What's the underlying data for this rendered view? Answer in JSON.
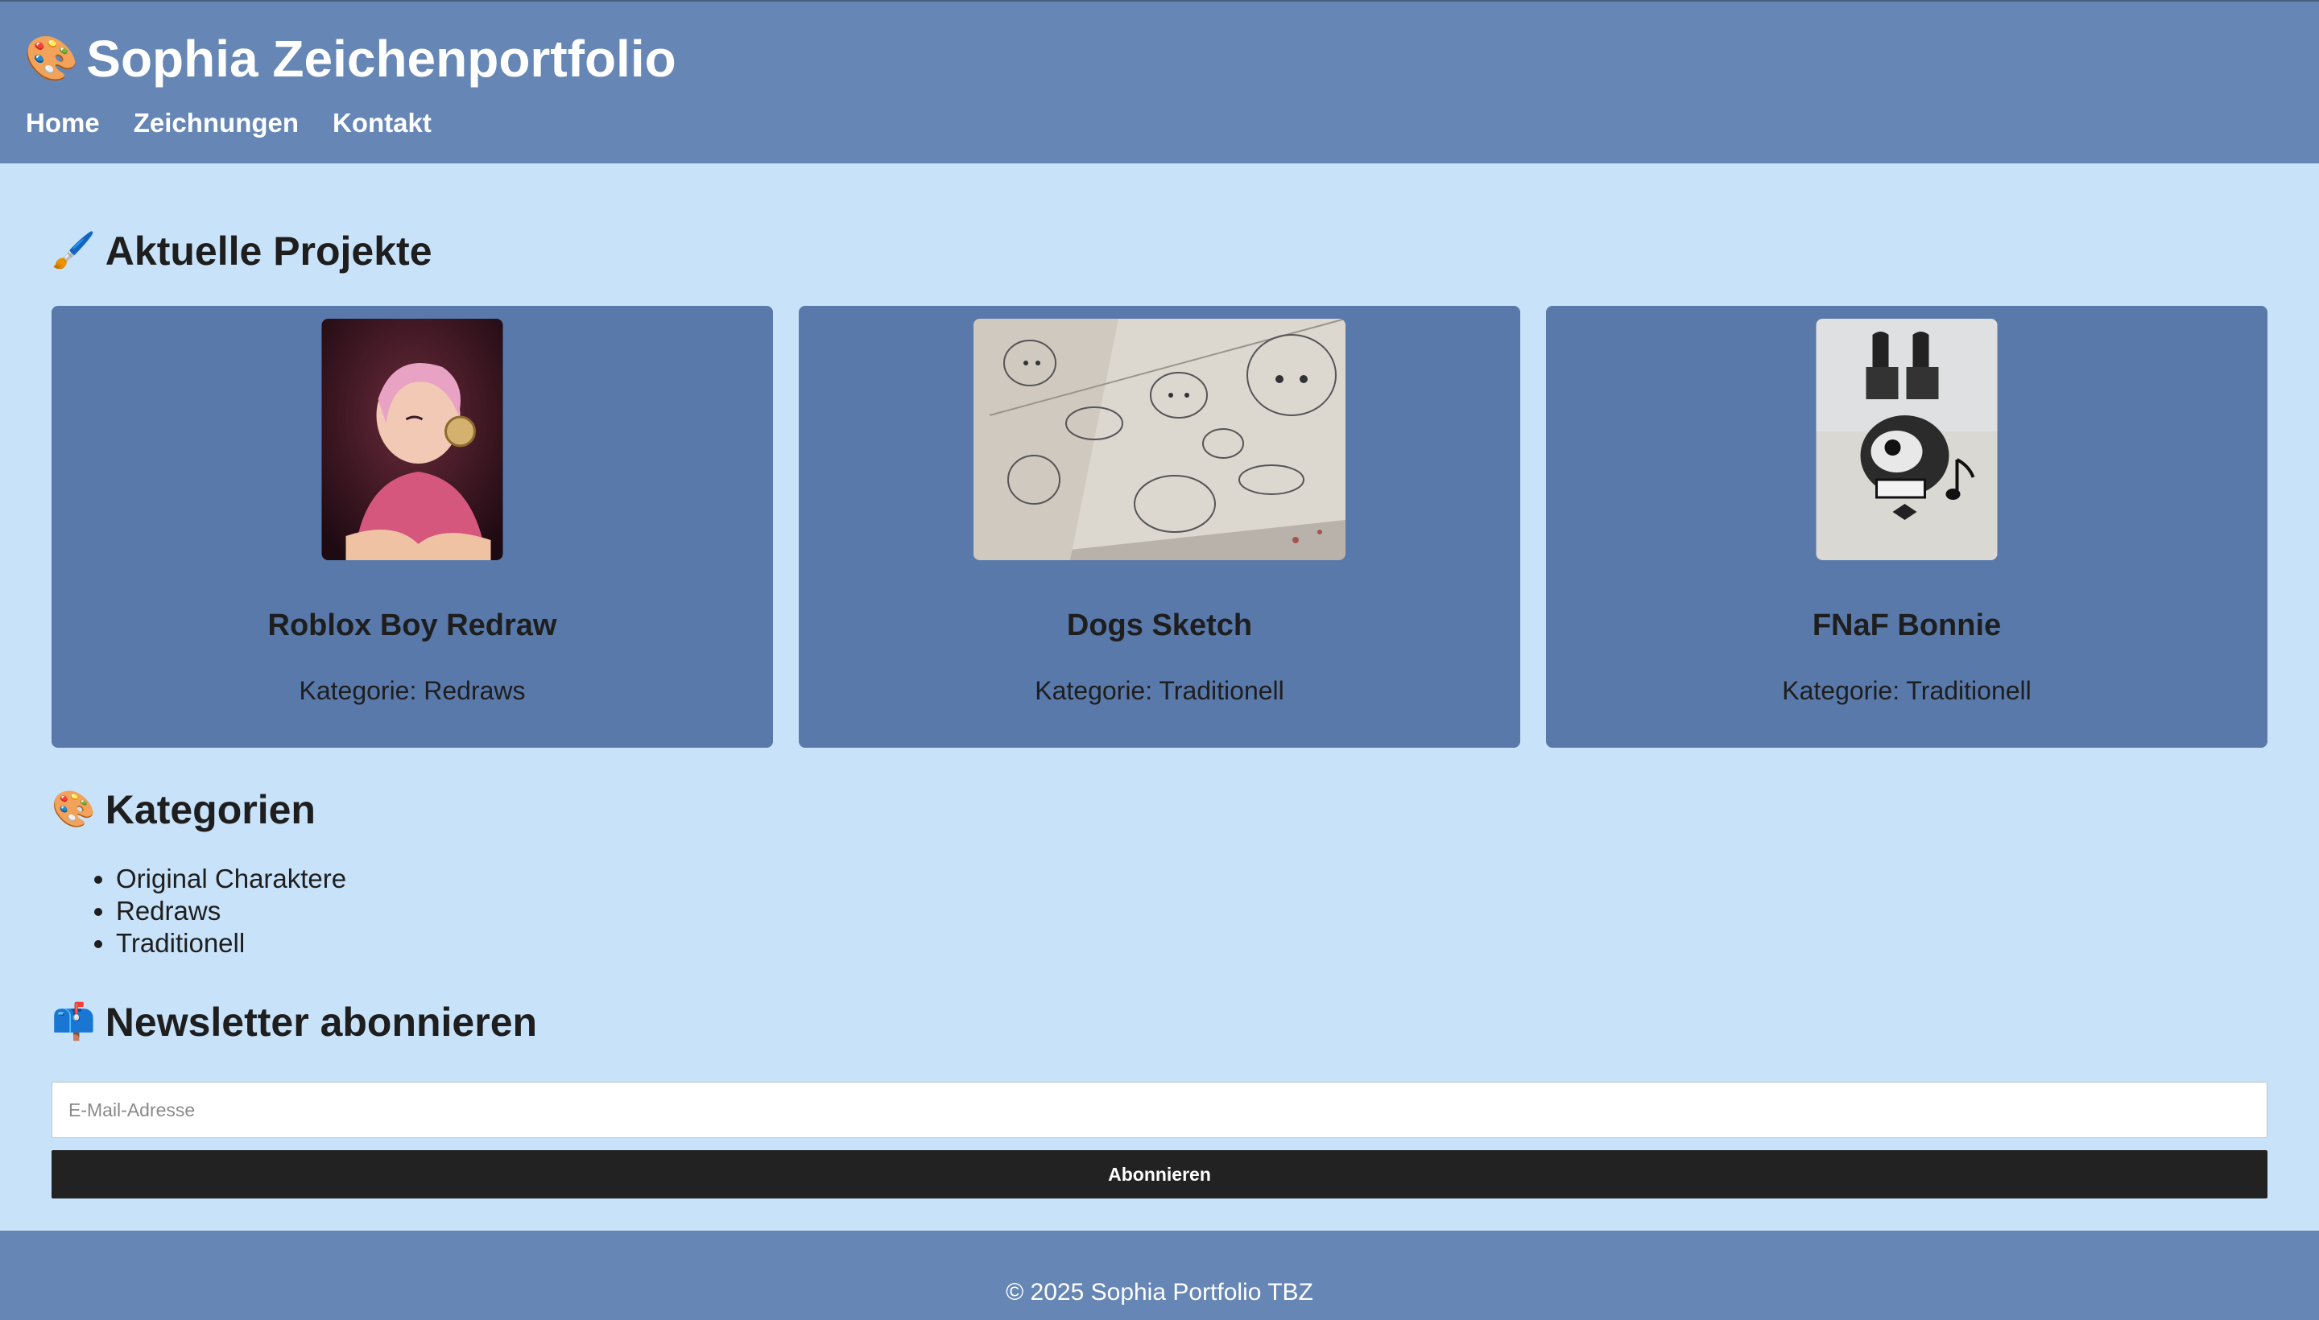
{
  "header": {
    "title_icon": "🎨",
    "title": "Sophia Zeichenportfolio",
    "nav": [
      {
        "label": "Home"
      },
      {
        "label": "Zeichnungen"
      },
      {
        "label": "Kontakt"
      }
    ]
  },
  "projects": {
    "icon": "🖌️",
    "title": "Aktuelle Projekte",
    "cards": [
      {
        "name": "Roblox Boy Redraw",
        "category": "Kategorie: Redraws",
        "image_icon": "portrait-drawing"
      },
      {
        "name": "Dogs Sketch",
        "category": "Kategorie: Traditionell",
        "image_icon": "dog-sketches"
      },
      {
        "name": "FNaF Bonnie",
        "category": "Kategorie: Traditionell",
        "image_icon": "bonnie-sketch"
      }
    ]
  },
  "categories": {
    "icon": "🎨",
    "title": "Kategorien",
    "items": [
      "Original Charaktere",
      "Redraws",
      "Traditionell"
    ]
  },
  "newsletter": {
    "icon": "📫",
    "title": "Newsletter abonnieren",
    "email_placeholder": "E-Mail-Adresse",
    "button_label": "Abonnieren"
  },
  "footer": {
    "text": "© 2025 Sophia Portfolio TBZ"
  },
  "colors": {
    "header_bg": "#6687b5",
    "page_bg": "#c8e2f9",
    "card_bg": "#5879aa",
    "button_bg": "#222222"
  }
}
